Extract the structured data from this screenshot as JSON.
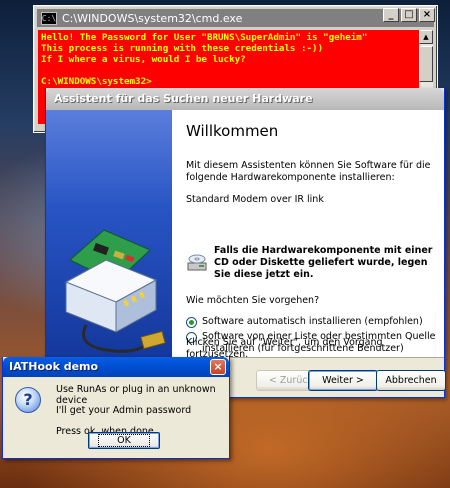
{
  "cmd": {
    "title": "C:\\WINDOWS\\system32\\cmd.exe",
    "lines": [
      "Hello! The Password for User \"BRUNS\\SuperAdmin\" is \"geheim\"",
      "This process is running with these credentials :-))",
      "If I where a virus, would I be lucky?",
      "",
      "C:\\WINDOWS\\system32>"
    ],
    "bg_color": "#ff0000",
    "text_color": "#ffff00"
  },
  "wizard": {
    "title": "Assistent für das Suchen neuer Hardware",
    "heading": "Willkommen",
    "intro": "Mit diesem Assistenten können Sie Software für die folgende Hardwarekomponente installieren:",
    "device": "Standard Modem over IR link",
    "cd_hint": "Falls die Hardwarekomponente mit einer CD oder Diskette geliefert wurde, legen Sie diese jetzt ein.",
    "question": "Wie möchten Sie vorgehen?",
    "option_auto": "Software automatisch installieren (empfohlen)",
    "option_manual": "Software von einer Liste oder bestimmten Quelle installieren (für fortgeschrittene Benutzer)",
    "continue_hint": "Klicken Sie auf \"Weiter\", um den Vorgang fortzusetzen.",
    "back_label": "< Zurück",
    "next_label": "Weiter >",
    "cancel_label": "Abbrechen"
  },
  "iathook": {
    "title": "IATHook demo",
    "line1": "Use RunAs or plug in an unknown device",
    "line2": "I'll get your Admin password",
    "line3": "Press ok, when done.",
    "ok_label": "OK"
  }
}
